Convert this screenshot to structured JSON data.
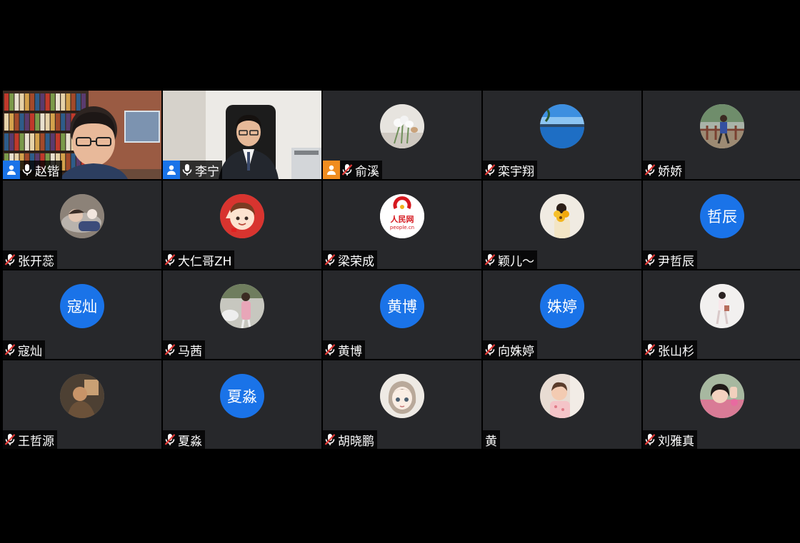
{
  "participants": [
    {
      "name": "赵锴",
      "kind": "video",
      "scene": "bookshelf",
      "role": "host",
      "mic": "on"
    },
    {
      "name": "李宁",
      "kind": "video",
      "scene": "office",
      "role": "host",
      "mic": "on"
    },
    {
      "name": "俞溪",
      "kind": "photo",
      "avatar": "flowers",
      "role": "cohost",
      "mic": "off"
    },
    {
      "name": "栾宇翔",
      "kind": "photo",
      "avatar": "lake",
      "mic": "off"
    },
    {
      "name": "娇娇",
      "kind": "photo",
      "avatar": "railing",
      "mic": "off"
    },
    {
      "name": "张开蕊",
      "kind": "photo",
      "avatar": "sleeping",
      "mic": "off"
    },
    {
      "name": "大仁哥ZH",
      "kind": "photo",
      "avatar": "cartoon-boy",
      "mic": "off"
    },
    {
      "name": "梁荣成",
      "kind": "photo",
      "avatar": "people-cn-logo",
      "avatar_text": "人民网",
      "avatar_subtext": "people.cn",
      "mic": "off"
    },
    {
      "name": "颖儿～",
      "kind": "photo",
      "avatar": "sunflowers",
      "mic": "off"
    },
    {
      "name": "尹哲辰",
      "kind": "initials",
      "initials": "哲辰",
      "mic": "off"
    },
    {
      "name": "寇灿",
      "kind": "initials",
      "initials": "寇灿",
      "mic": "off"
    },
    {
      "name": "马茜",
      "kind": "photo",
      "avatar": "woman-pink",
      "mic": "off"
    },
    {
      "name": "黄博",
      "kind": "initials",
      "initials": "黄博",
      "mic": "off"
    },
    {
      "name": "向姝婷",
      "kind": "initials",
      "initials": "姝婷",
      "mic": "off"
    },
    {
      "name": "张山杉",
      "kind": "photo",
      "avatar": "figure-white",
      "mic": "off"
    },
    {
      "name": "王哲源",
      "kind": "photo",
      "avatar": "dim-person",
      "mic": "off"
    },
    {
      "name": "夏淼",
      "kind": "initials",
      "initials": "夏淼",
      "mic": "off"
    },
    {
      "name": "胡晓鹏",
      "kind": "photo",
      "avatar": "cartoon-girl",
      "mic": "off"
    },
    {
      "name": "黄",
      "kind": "photo",
      "avatar": "toddler",
      "mic": "none"
    },
    {
      "name": "刘雅真",
      "kind": "photo",
      "avatar": "woman-selfie",
      "mic": "off"
    }
  ],
  "colors": {
    "tile": "#27282b",
    "initials_bg": "#1a73e8",
    "host_badge": "#1a73e8",
    "cohost_badge": "#f08c1f",
    "muted_slash": "#e53935"
  }
}
